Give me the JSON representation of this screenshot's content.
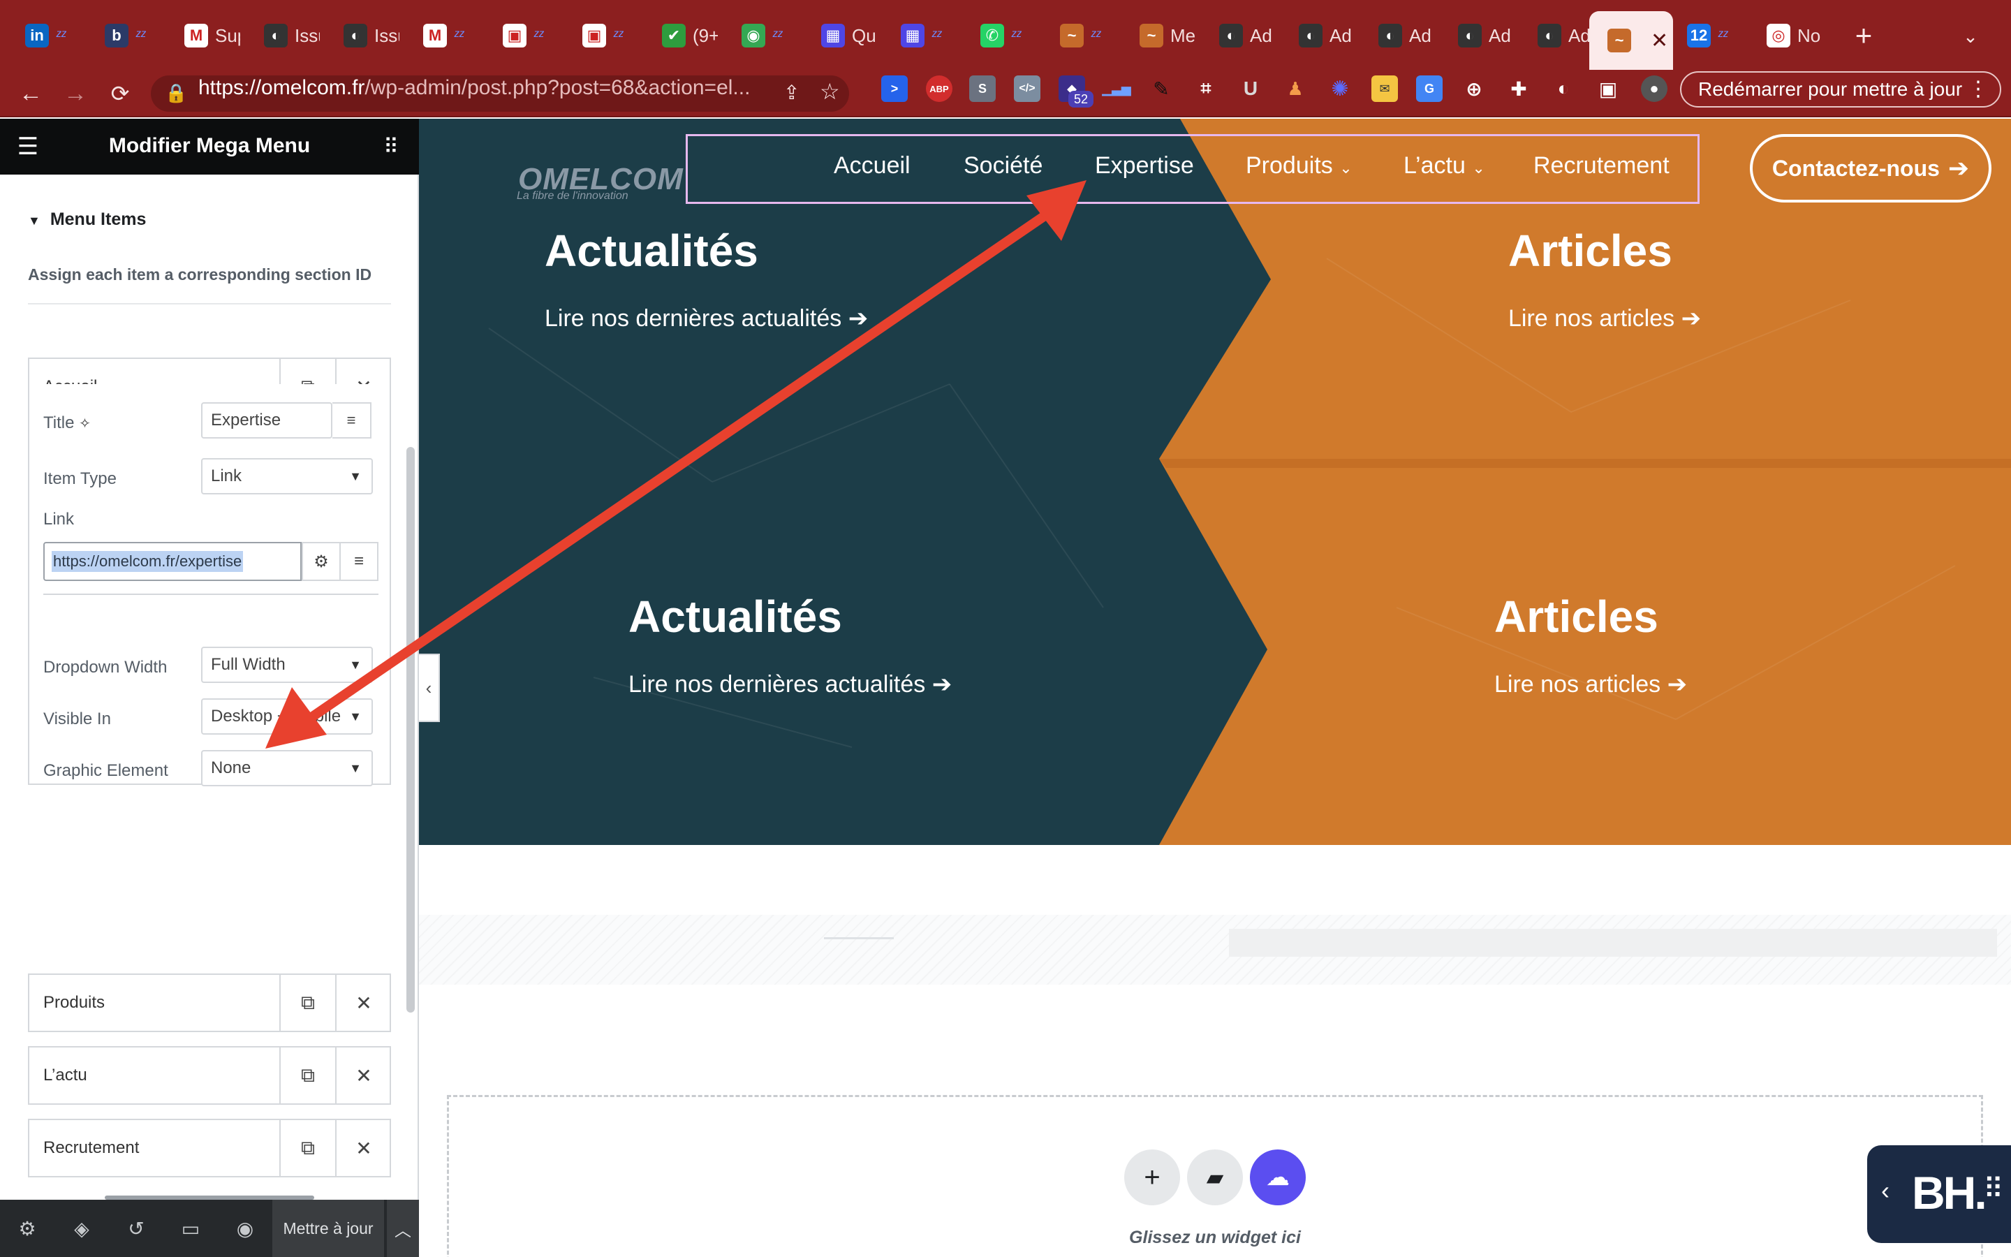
{
  "browser": {
    "tabs": [
      {
        "label": "",
        "icon": "linkedin-icon",
        "color": "#0a66c2",
        "glyph": "in"
      },
      {
        "label": "",
        "icon": "b-icon",
        "color": "#2b3a67",
        "glyph": "b"
      },
      {
        "label": "Sup",
        "icon": "gmail-icon",
        "color": "#ffffff",
        "glyph": "M"
      },
      {
        "label": "Issu",
        "icon": "github-icon",
        "color": "#333333",
        "glyph": "◐"
      },
      {
        "label": "Issu",
        "icon": "github-icon",
        "color": "#333333",
        "glyph": "◐"
      },
      {
        "label": "",
        "icon": "gmail-icon",
        "color": "#ffffff",
        "glyph": "M"
      },
      {
        "label": "",
        "icon": "package-icon",
        "color": "#ffffff",
        "glyph": "▣"
      },
      {
        "label": "",
        "icon": "package-icon",
        "color": "#ffffff",
        "glyph": "▣"
      },
      {
        "label": "(9+",
        "icon": "check-icon",
        "color": "#2e9d3e",
        "glyph": "✔"
      },
      {
        "label": "",
        "icon": "maps-icon",
        "color": "#34a853",
        "glyph": "◉"
      },
      {
        "label": "Qu",
        "icon": "calendar-icon",
        "color": "#4f46e5",
        "glyph": "▦"
      },
      {
        "label": "",
        "icon": "calendar-icon",
        "color": "#4f46e5",
        "glyph": "▦"
      },
      {
        "label": "",
        "icon": "whatsapp-icon",
        "color": "#25d366",
        "glyph": "✆"
      },
      {
        "label": "",
        "icon": "omelcom-icon",
        "color": "#c56a2b",
        "glyph": "~"
      },
      {
        "label": "Me",
        "icon": "omelcom-icon",
        "color": "#c56a2b",
        "glyph": "~"
      },
      {
        "label": "Ad",
        "icon": "github-icon",
        "color": "#333333",
        "glyph": "◐"
      },
      {
        "label": "Ad",
        "icon": "github-icon",
        "color": "#333333",
        "glyph": "◐"
      },
      {
        "label": "Ad",
        "icon": "github-icon",
        "color": "#333333",
        "glyph": "◐"
      },
      {
        "label": "Ad",
        "icon": "github-icon",
        "color": "#333333",
        "glyph": "◐"
      },
      {
        "label": "Ad",
        "icon": "github-icon",
        "color": "#333333",
        "glyph": "◐"
      },
      {
        "label": "",
        "icon": "omelcom-icon",
        "color": "#c56a2b",
        "glyph": "~",
        "active": true
      },
      {
        "label": "",
        "icon": "calendar-icon",
        "color": "#1a73e8",
        "glyph": "12"
      },
      {
        "label": "No",
        "icon": "chrome-icon",
        "color": "#ffffff",
        "glyph": "◎"
      }
    ],
    "url_host": "https://omelcom.fr",
    "url_path": "/wp-admin/post.php?post=68&action=el...",
    "extension_badge": "52",
    "update_label": "Redémarrer pour mettre à jour"
  },
  "editor": {
    "title": "Modifier Mega Menu",
    "section_title": "Menu Items",
    "section_desc": "Assign each item a corresponding section ID",
    "items": [
      "Accueil",
      "Société",
      "Expertise",
      "Produits",
      "L’actu",
      "Recrutement"
    ],
    "fields": {
      "title_label": "Title",
      "title_value": "Expertise",
      "item_type_label": "Item Type",
      "item_type_value": "Link",
      "link_label": "Link",
      "link_value": "https://omelcom.fr/expertise",
      "dropdown_width_label": "Dropdown Width",
      "dropdown_width_value": "Full Width",
      "visible_in_label": "Visible In",
      "visible_in_value": "Desktop + Mobile",
      "graphic_element_label": "Graphic Element",
      "graphic_element_value": "None"
    },
    "footer": {
      "save_label": "Mettre à jour"
    }
  },
  "site": {
    "logo": "OMELCOM",
    "logo_tagline": "La fibre de l'innovation",
    "nav": [
      "Accueil",
      "Société",
      "Expertise",
      "Produits",
      "L’actu",
      "Recrutement"
    ],
    "contact_label": "Contactez-nous",
    "hero": [
      {
        "heading": "Actualités",
        "link": "Lire nos dernières actualités"
      },
      {
        "heading": "Articles",
        "link": "Lire nos articles"
      },
      {
        "heading": "Actualités",
        "link": "Lire nos dernières actualités"
      },
      {
        "heading": "Articles",
        "link": "Lire nos articles"
      }
    ],
    "dropzone_text": "Glissez un widget ici",
    "widget_text": "BH."
  },
  "colors": {
    "chrome": "#8c1f1f",
    "teal": "#1c3d48",
    "orange": "#d07a2c",
    "arrow": "#e8412e",
    "nav_outline": "#e6b8ee",
    "ai_button": "#5b4ef0"
  }
}
